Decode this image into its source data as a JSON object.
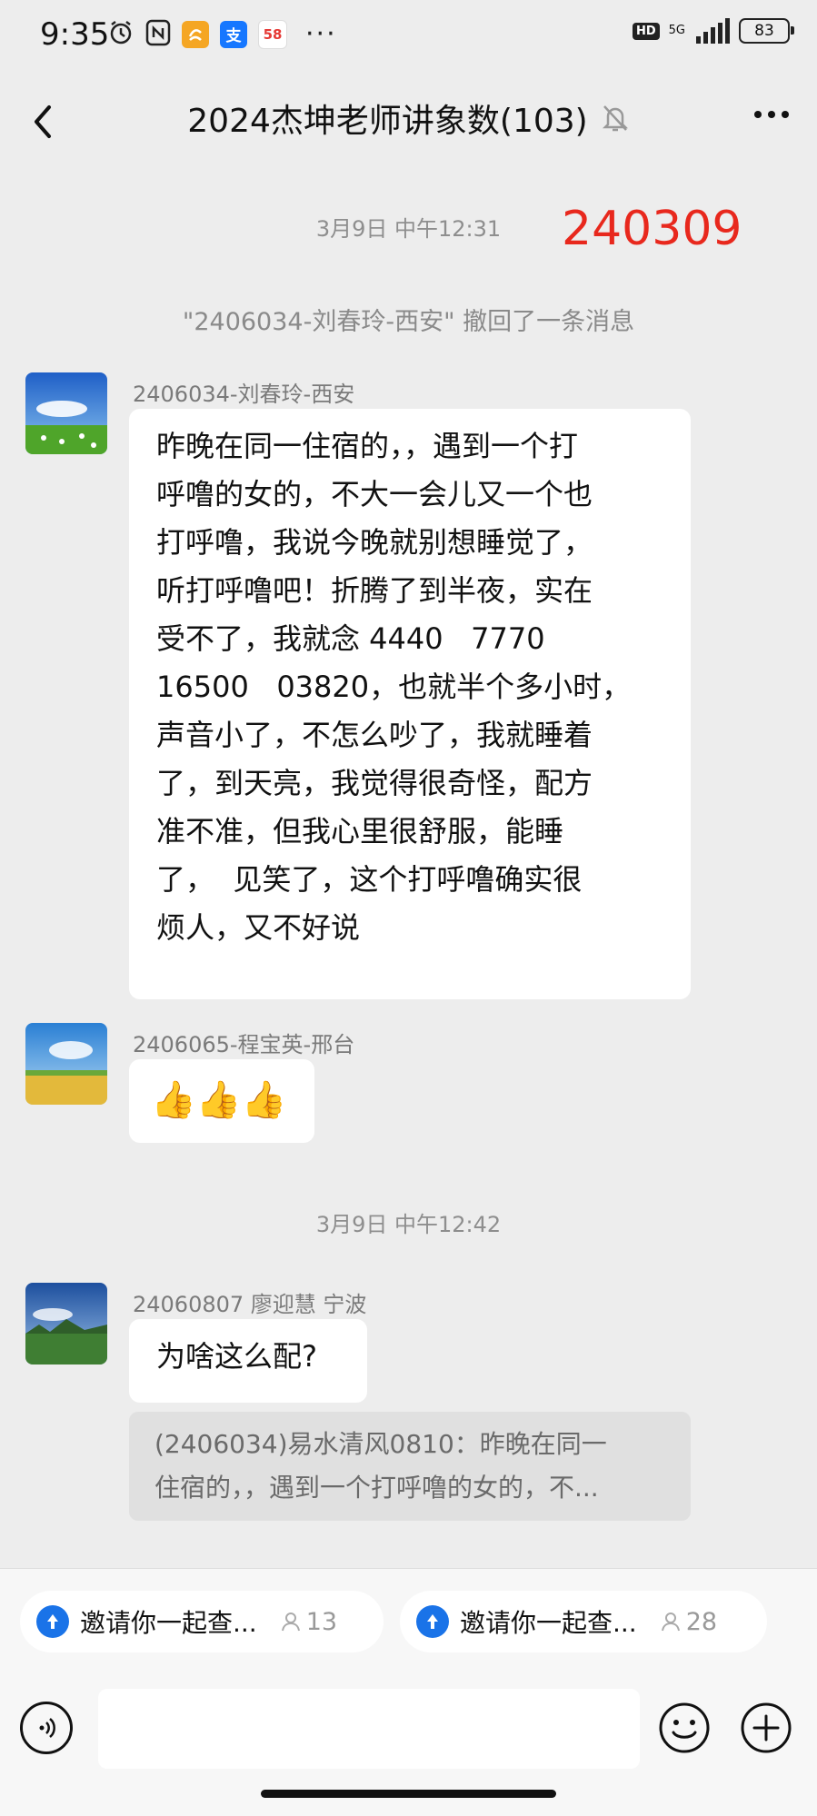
{
  "status_bar": {
    "time": "9:35",
    "app_icons": [
      "alarm-icon",
      "nfc-icon",
      "app-orange-icon",
      "alipay-icon",
      "58-app-icon"
    ],
    "alipay_glyph": "支",
    "app58_glyph": "58",
    "more": "···",
    "hd": "HD",
    "network": "5G",
    "battery": "83"
  },
  "header": {
    "title": "2024杰坤老师讲象数(103)",
    "muted": true
  },
  "messages": {
    "time1": "3月9日 中午12:31",
    "annotation": "240309",
    "recall_notice": "\"2406034-刘春玲-西安\" 撤回了一条消息",
    "m1": {
      "sender": "2406034-刘春玲-西安",
      "lines": [
        "昨晚在同一住宿的，，遇到一个打",
        "呼噜的女的，不大一会儿又一个也",
        "打呼噜，我说今晚就别想睡觉了，",
        "听打呼噜吧！折腾了到半夜，实在",
        "受不了，我就念 4440   7770",
        "16500   03820，也就半个多小时，",
        "声音小了，不怎么吵了，我就睡着",
        "了，到天亮，我觉得很奇怪，配方",
        "准不准，但我心里很舒服，能睡",
        "了，  见笑了，这个打呼噜确实很",
        "烦人，又不好说"
      ]
    },
    "m2": {
      "sender": "2406065-程宝英-邢台",
      "text": "👍👍👍"
    },
    "time2": "3月9日 中午12:42",
    "m3": {
      "sender": "24060807 廖迎慧 宁波",
      "text": "为啥这么配?",
      "quote_lines": [
        "(2406034)易水清风0810：昨晚在同一",
        "住宿的，，遇到一个打呼噜的女的，不..."
      ]
    }
  },
  "bottom": {
    "chips": [
      {
        "label": "邀请你一起查...",
        "count": "13"
      },
      {
        "label": "邀请你一起查...",
        "count": "28"
      }
    ],
    "input_placeholder": ""
  }
}
